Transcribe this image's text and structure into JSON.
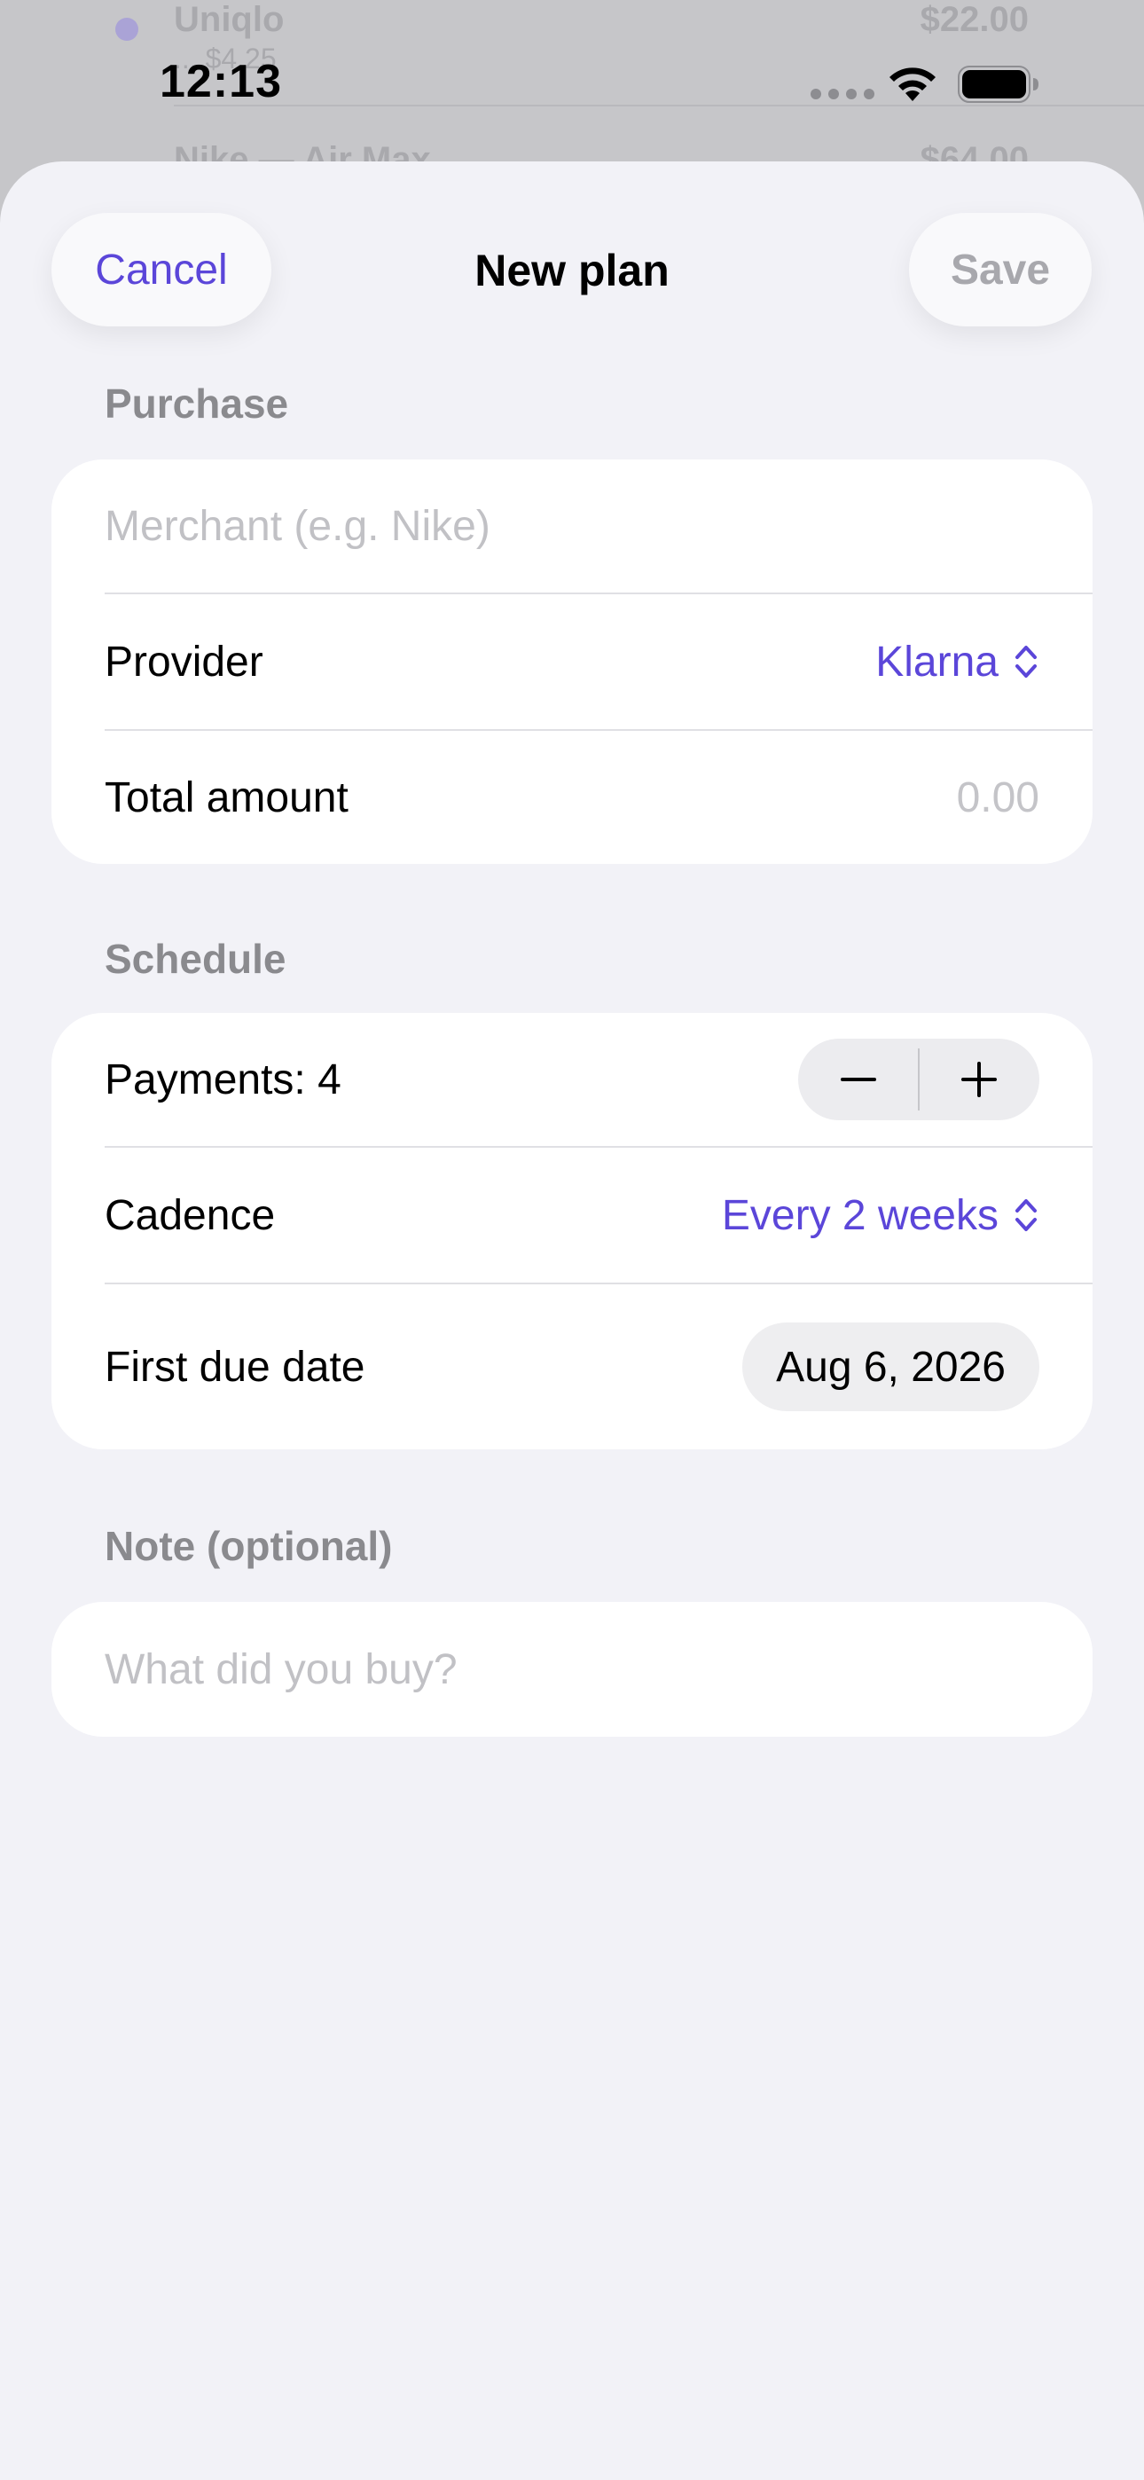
{
  "background": {
    "rows": [
      {
        "name": "Uniqlo",
        "sub": "... $4.25",
        "amount": "$22.00"
      },
      {
        "name": "Nike — Air Max",
        "amount": "$64.00"
      }
    ]
  },
  "status_bar": {
    "time": "12:13"
  },
  "nav": {
    "cancel_label": "Cancel",
    "title": "New plan",
    "save_label": "Save"
  },
  "purchase": {
    "header": "Purchase",
    "merchant_placeholder": "Merchant (e.g. Nike)",
    "provider_label": "Provider",
    "provider_value": "Klarna",
    "total_label": "Total amount",
    "total_placeholder": "0.00"
  },
  "schedule": {
    "header": "Schedule",
    "payments_label": "Payments: 4",
    "payments_count": 4,
    "cadence_label": "Cadence",
    "cadence_value": "Every 2 weeks",
    "due_label": "First due date",
    "due_value": "Aug 6, 2026"
  },
  "note": {
    "header": "Note (optional)",
    "placeholder": "What did you buy?"
  },
  "colors": {
    "accent": "#5b46d9",
    "background": "#f2f2f7",
    "card": "#ffffff",
    "secondary_text": "#8a8a8e"
  }
}
